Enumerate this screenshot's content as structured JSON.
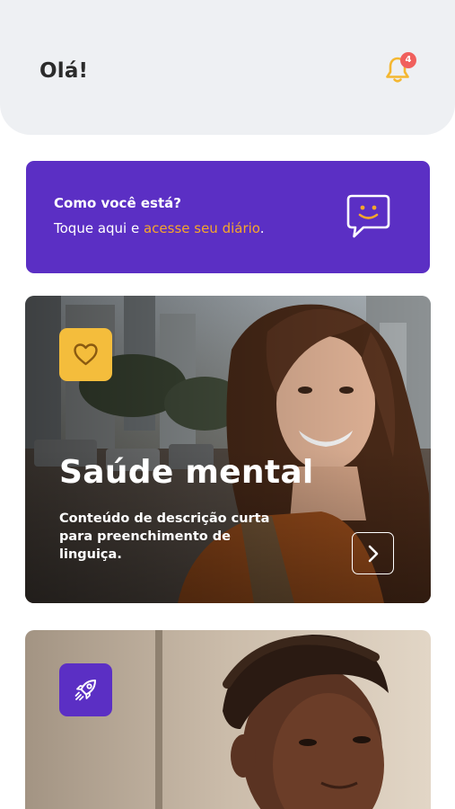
{
  "header": {
    "greeting": "Olá!",
    "notification_count": "4"
  },
  "mood_card": {
    "title": "Como você está?",
    "text_prefix": "Toque aqui e ",
    "link_text": "acesse seu diário",
    "text_suffix": "."
  },
  "cards": [
    {
      "icon": "heart-icon",
      "title": "Saúde mental",
      "description": "Conteúdo de descrição curta para preenchimento de linguiça."
    },
    {
      "icon": "rocket-icon"
    }
  ],
  "colors": {
    "primary": "#5b2fc4",
    "accent": "#f6a72b",
    "heart_tile": "#f4bd3c",
    "badge": "#f0605d",
    "header_bg": "#eef0f3"
  }
}
